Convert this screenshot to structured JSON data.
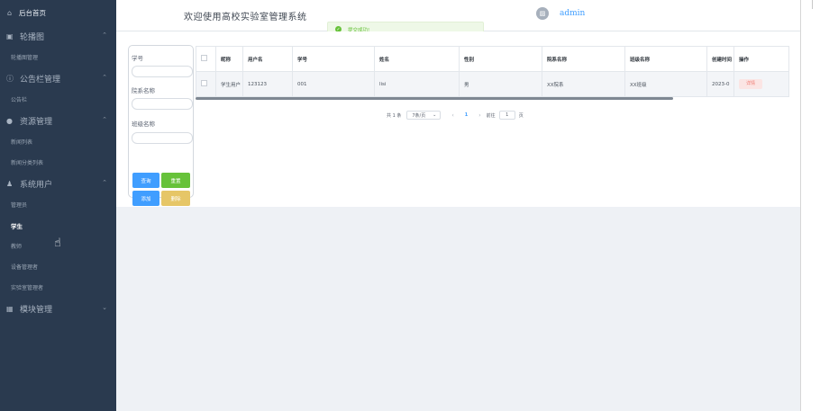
{
  "sidebar": {
    "home_label": "后台首页",
    "groups": [
      {
        "label": "轮播图",
        "icon": "picture-icon",
        "items": [
          "轮播图管理"
        ]
      },
      {
        "label": "公告栏管理",
        "icon": "info-circle-icon",
        "items": [
          "公告栏"
        ]
      },
      {
        "label": "资源管理",
        "icon": "location-icon",
        "items": [
          "新闻列表",
          "新闻分类列表"
        ]
      },
      {
        "label": "系统用户",
        "icon": "user-icon",
        "items": [
          "管理员",
          "学生",
          "教师",
          "设备管理者",
          "实验室管理者"
        ]
      },
      {
        "label": "模块管理",
        "icon": "grid-icon",
        "items": []
      }
    ],
    "active_item": "学生"
  },
  "header": {
    "title": "欢迎使用高校实验室管理系统",
    "toast": "提交成功!",
    "username": "admin"
  },
  "filter": {
    "fields": [
      {
        "label": "学号",
        "value": ""
      },
      {
        "label": "院系名称",
        "value": ""
      },
      {
        "label": "班级名称",
        "value": ""
      }
    ],
    "buttons": {
      "query": "查询",
      "reset": "重置",
      "add": "添加",
      "delete": "删除"
    }
  },
  "table": {
    "columns": [
      "",
      "昵称",
      "用户名",
      "学号",
      "姓名",
      "性别",
      "院系名称",
      "班级名称",
      "创建时间",
      "操作"
    ],
    "rows": [
      {
        "nickname": "学生用户",
        "username": "123123",
        "student_id": "001",
        "name": "lisi",
        "gender": "男",
        "department": "XX院系",
        "class": "XX班级",
        "created": "2023-0",
        "action": "详情"
      }
    ]
  },
  "pagination": {
    "total": "共 1 条",
    "page_size": "7条/页",
    "current": "1",
    "goto_label": "前往",
    "goto_value": "1",
    "page_suffix": "页"
  },
  "colors": {
    "sidebar_bg": "#2a3a4f",
    "primary": "#409eff",
    "success": "#67c23a",
    "warning": "#e6c667",
    "danger_light": "#fbe5e4"
  }
}
